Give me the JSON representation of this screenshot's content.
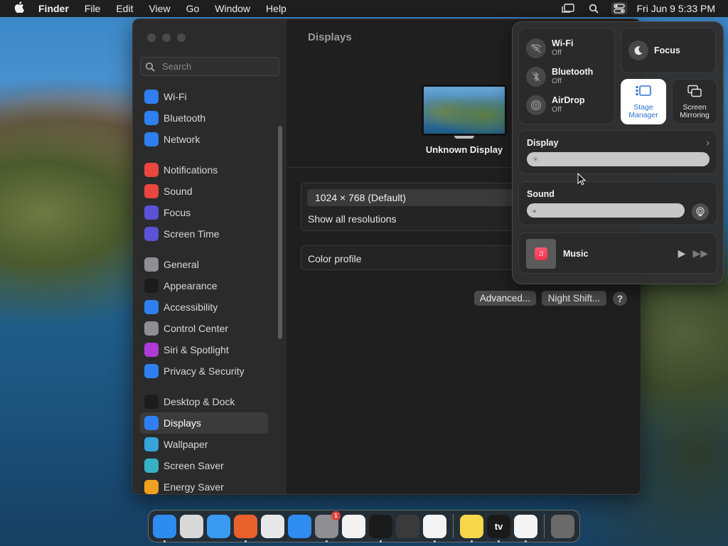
{
  "menubar": {
    "app": "Finder",
    "items": [
      "File",
      "Edit",
      "View",
      "Go",
      "Window",
      "Help"
    ],
    "clock": "Fri Jun 9  5:33 PM"
  },
  "window": {
    "search_placeholder": "Search",
    "title": "Displays",
    "sidebar": [
      {
        "label": "Wi-Fi",
        "icon": "wifi-icon",
        "color": "#2f7ff0"
      },
      {
        "label": "Bluetooth",
        "icon": "bluetooth-icon",
        "color": "#2f7ff0"
      },
      {
        "label": "Network",
        "icon": "globe-icon",
        "color": "#2f7ff0"
      },
      {
        "label": "Notifications",
        "icon": "bell-icon",
        "color": "#e8463f"
      },
      {
        "label": "Sound",
        "icon": "speaker-icon",
        "color": "#e8463f"
      },
      {
        "label": "Focus",
        "icon": "moon-icon",
        "color": "#5b52d6"
      },
      {
        "label": "Screen Time",
        "icon": "hourglass-icon",
        "color": "#5b52d6"
      },
      {
        "label": "General",
        "icon": "gear-icon",
        "color": "#8e8e93"
      },
      {
        "label": "Appearance",
        "icon": "appearance-icon",
        "color": "#1c1c1e"
      },
      {
        "label": "Accessibility",
        "icon": "accessibility-icon",
        "color": "#2f7ff0"
      },
      {
        "label": "Control Center",
        "icon": "control-center-icon",
        "color": "#8e8e93"
      },
      {
        "label": "Siri & Spotlight",
        "icon": "siri-icon",
        "color": "#b03ad6"
      },
      {
        "label": "Privacy & Security",
        "icon": "hand-icon",
        "color": "#2f7ff0"
      },
      {
        "label": "Desktop & Dock",
        "icon": "dock-icon",
        "color": "#1c1c1e"
      },
      {
        "label": "Displays",
        "icon": "sun-icon",
        "color": "#2f7ff0"
      },
      {
        "label": "Wallpaper",
        "icon": "wallpaper-icon",
        "color": "#36a3d9"
      },
      {
        "label": "Screen Saver",
        "icon": "screensaver-icon",
        "color": "#36b0c4"
      },
      {
        "label": "Energy Saver",
        "icon": "battery-icon",
        "color": "#f0a020"
      }
    ],
    "selected": "Displays",
    "monitor_name": "Unknown Display",
    "resolution_selected": "1024 × 768 (Default)",
    "resolution_show_all": "Show all resolutions",
    "color_profile_label": "Color profile",
    "advanced_button": "Advanced...",
    "night_shift_button": "Night Shift...",
    "help_button": "?"
  },
  "control_center": {
    "wifi": {
      "title": "Wi-Fi",
      "status": "Off"
    },
    "bluetooth": {
      "title": "Bluetooth",
      "status": "Off"
    },
    "airdrop": {
      "title": "AirDrop",
      "status": "Off"
    },
    "focus": "Focus",
    "stage_manager": "Stage Manager",
    "screen_mirroring": "Screen Mirroring",
    "display": {
      "title": "Display",
      "level": 0.0
    },
    "sound": {
      "title": "Sound",
      "level": 0.0
    },
    "music": {
      "title": "Music"
    },
    "accent_color": "#2e72d2"
  },
  "dock": {
    "apps": [
      {
        "name": "Finder",
        "icon": "finder-icon",
        "color": "#2c8cf0",
        "running": true
      },
      {
        "name": "Launchpad",
        "icon": "launchpad-icon",
        "color": "#d8d8d8",
        "running": false
      },
      {
        "name": "Safari",
        "icon": "safari-icon",
        "color": "#3a9af0",
        "running": false
      },
      {
        "name": "Firefox",
        "icon": "firefox-icon",
        "color": "#e8602c",
        "running": true
      },
      {
        "name": "Chrome",
        "icon": "chrome-icon",
        "color": "#e8e8e8",
        "running": false
      },
      {
        "name": "App Store",
        "icon": "app-store-icon",
        "color": "#2f8cf0",
        "running": false
      },
      {
        "name": "System Settings",
        "icon": "settings-icon",
        "color": "#8e8e93",
        "running": true,
        "badge": "1"
      },
      {
        "name": "TextEdit",
        "icon": "textedit-icon",
        "color": "#f2f2f2",
        "running": false
      },
      {
        "name": "Terminal",
        "icon": "terminal-icon",
        "color": "#1a1a1a",
        "running": true
      },
      {
        "name": "GarageBand",
        "icon": "guitar-icon",
        "color": "#3a3a3a",
        "running": false
      },
      {
        "name": "VS Code",
        "icon": "vscode-icon",
        "color": "#f4f4f4",
        "running": true
      },
      {
        "name": "Notes",
        "icon": "notes-icon",
        "color": "#f7d64a",
        "running": true
      },
      {
        "name": "Apple TV",
        "icon": "tv-icon",
        "color": "#1a1a1a",
        "running": true,
        "label": "tv"
      },
      {
        "name": "News",
        "icon": "news-icon",
        "color": "#f4f4f4",
        "running": true
      },
      {
        "name": "Trash",
        "icon": "trash-icon",
        "color": "#6a6a6a",
        "running": false
      }
    ]
  }
}
